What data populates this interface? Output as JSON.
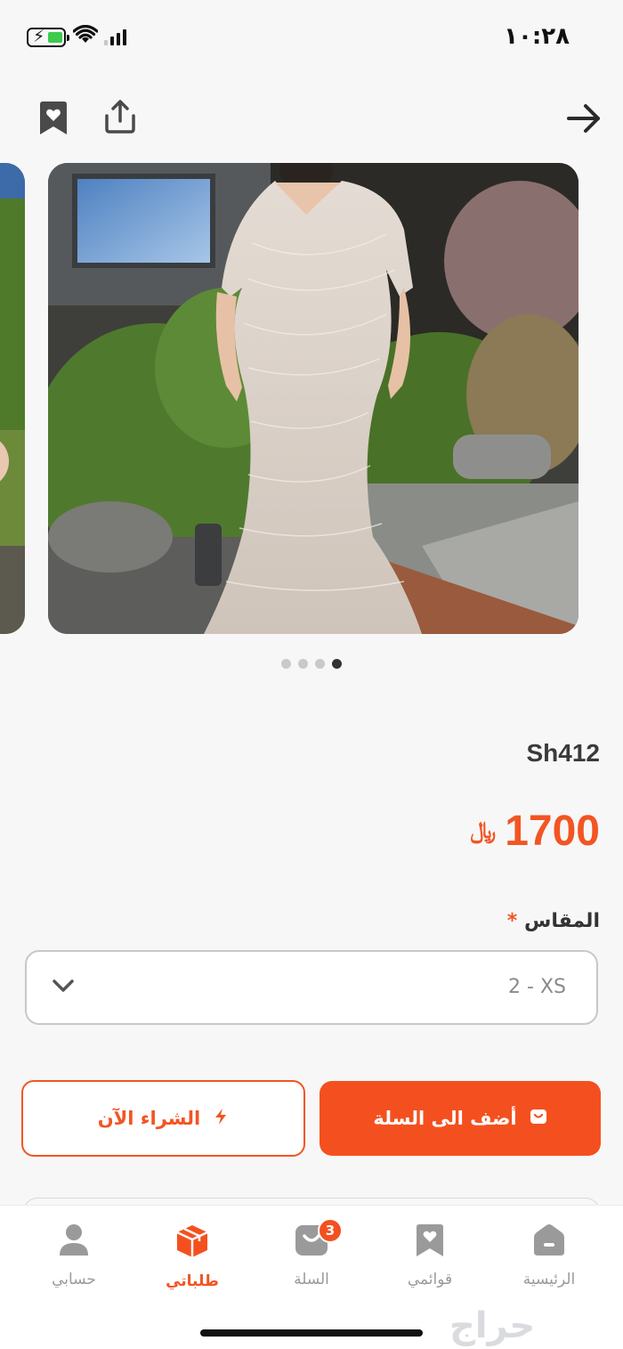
{
  "status_bar": {
    "time": "١٠:٢٨"
  },
  "product": {
    "sku": "Sh412",
    "price": "1700",
    "currency_symbol": "﷼",
    "size_label": "المقاس",
    "required_mark": "*",
    "selected_size": "2 - XS",
    "image_dots": {
      "count": 4,
      "active_index": 3
    }
  },
  "actions": {
    "buy_now_label": "الشراء الآن",
    "add_to_cart_label": "أضف الى السلة"
  },
  "bottom_nav": {
    "items": [
      {
        "label": "حسابي",
        "icon": "user-icon"
      },
      {
        "label": "طلباتي",
        "icon": "box-icon",
        "active": true
      },
      {
        "label": "السلة",
        "icon": "cart-icon",
        "badge": "3"
      },
      {
        "label": "قوائمي",
        "icon": "bookmark-icon"
      },
      {
        "label": "الرئيسية",
        "icon": "home-icon"
      }
    ]
  },
  "watermark": "حراج",
  "colors": {
    "accent": "#f4501f",
    "price": "#f25523"
  }
}
